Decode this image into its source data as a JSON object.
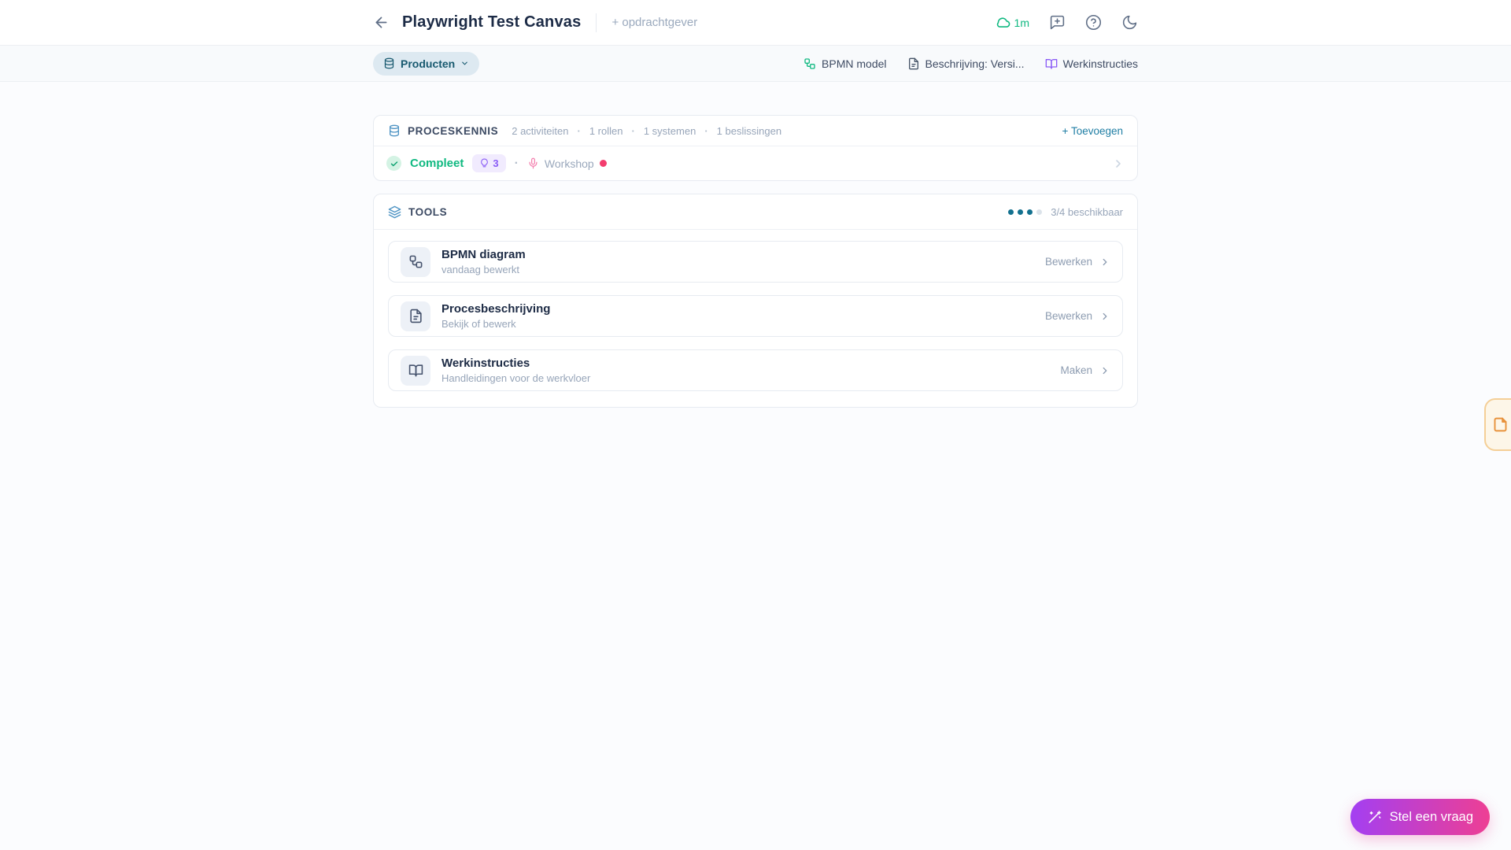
{
  "header": {
    "title": "Playwright Test Canvas",
    "add_client_label": "+ opdrachtgever",
    "sync_time": "1m"
  },
  "toolbar": {
    "products_label": "Producten",
    "links": [
      {
        "label": "BPMN model",
        "icon": "workflow-icon"
      },
      {
        "label": "Beschrijving: Versi...",
        "icon": "document-icon"
      },
      {
        "label": "Werkinstructies",
        "icon": "book-open-icon"
      }
    ]
  },
  "process_card": {
    "title": "PROCESKENNIS",
    "meta": [
      "2 activiteiten",
      "1 rollen",
      "1 systemen",
      "1 beslissingen"
    ],
    "separator": "·",
    "add_label": "+ Toevoegen",
    "status_label": "Compleet",
    "ideas_count": "3",
    "workshop_label": "Workshop"
  },
  "tools_card": {
    "title": "TOOLS",
    "dots_filled": 3,
    "dots_total": 4,
    "availability_label": "3/4 beschikbaar",
    "items": [
      {
        "title": "BPMN diagram",
        "subtitle": "vandaag bewerkt",
        "action_label": "Bewerken",
        "icon": "workflow-icon"
      },
      {
        "title": "Procesbeschrijving",
        "subtitle": "Bekijk of bewerk",
        "action_label": "Bewerken",
        "icon": "document-icon"
      },
      {
        "title": "Werkinstructies",
        "subtitle": "Handleidingen voor de werkvloer",
        "action_label": "Maken",
        "icon": "book-open-icon"
      }
    ]
  },
  "floating": {
    "ask_button_label": "Stel een vraag"
  },
  "colors": {
    "accent_green": "#10b981",
    "accent_purple": "#8a5cf6",
    "header_icon_blue": "#4f94c4",
    "dot_teal": "#13718f",
    "link_blue": "#1f7ea4",
    "workshop_dot_pink": "#f33d6e",
    "ask_gradient_start": "#a33ff2",
    "ask_gradient_end": "#ee3f93",
    "edge_tab_orange": "#e8923c"
  }
}
